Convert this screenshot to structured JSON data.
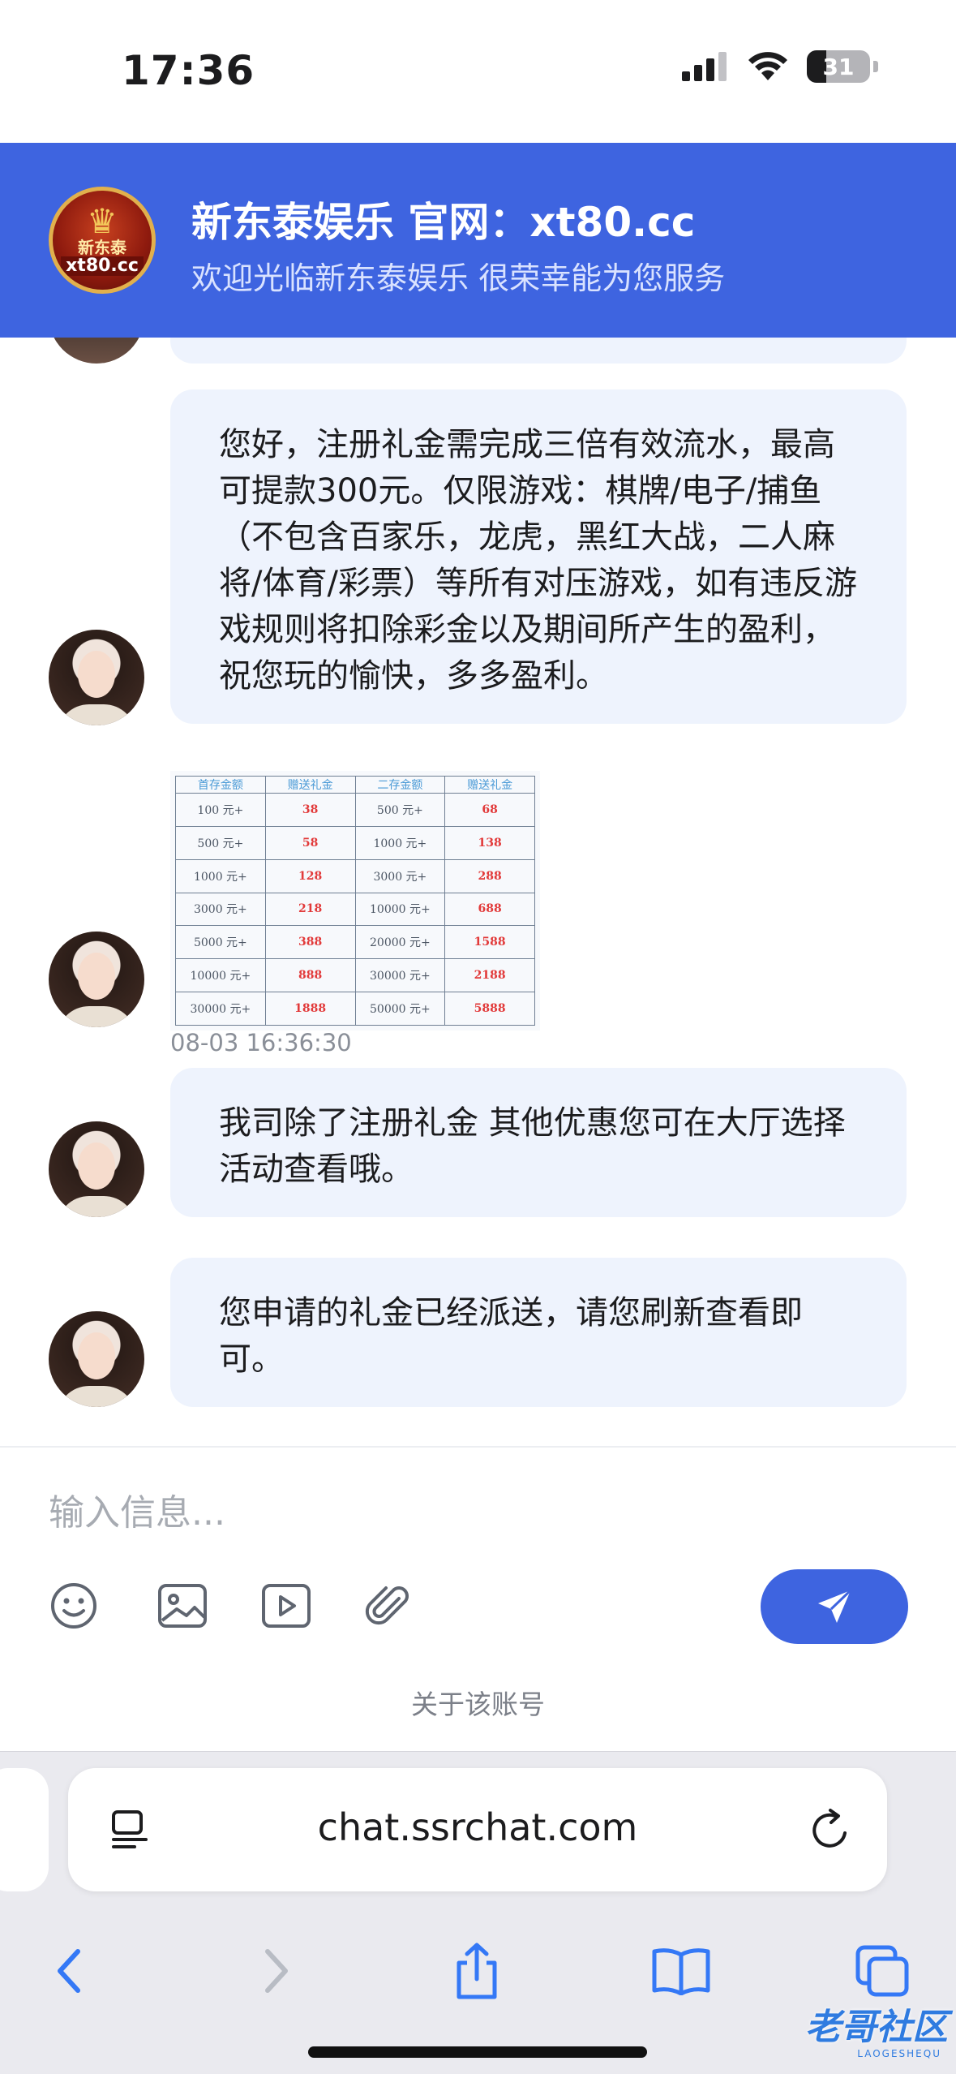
{
  "status_bar": {
    "time": "17:36",
    "battery": "31",
    "battery_level": 0.31
  },
  "header": {
    "logo_top": "新东泰",
    "logo_bottom": "xt80.cc",
    "title": "新东泰娱乐 官网：xt80.cc",
    "subtitle": "欢迎光临新东泰娱乐 很荣幸能为您服务"
  },
  "messages": [
    {
      "type": "text",
      "text": "您好，注册礼金需完成三倍有效流水，最高可提款300元。仅限游戏：棋牌/电子/捕鱼（不包含百家乐，龙虎，黑红大战，二人麻将/体育/彩票）等所有对压游戏，如有违反游戏规则将扣除彩金以及期间所产生的盈利，祝您玩的愉快，多多盈利。"
    },
    {
      "type": "image",
      "timestamp": "08-03 16:36:30",
      "table": {
        "headers": [
          "首存金额",
          "赠送礼金",
          "二存金额",
          "赠送礼金"
        ],
        "rows": [
          [
            "100 元+",
            "38",
            "500 元+",
            "68"
          ],
          [
            "500 元+",
            "58",
            "1000 元+",
            "138"
          ],
          [
            "1000 元+",
            "128",
            "3000 元+",
            "288"
          ],
          [
            "3000 元+",
            "218",
            "10000 元+",
            "688"
          ],
          [
            "5000 元+",
            "388",
            "20000 元+",
            "1588"
          ],
          [
            "10000 元+",
            "888",
            "30000 元+",
            "2188"
          ],
          [
            "30000 元+",
            "1888",
            "50000 元+",
            "5888"
          ]
        ]
      }
    },
    {
      "type": "text",
      "text": "我司除了注册礼金  其他优惠您可在大厅选择活动查看哦。"
    },
    {
      "type": "text",
      "text": "您申请的礼金已经派送，请您刷新查看即可。"
    }
  ],
  "composer": {
    "placeholder": "输入信息...",
    "tools": [
      "emoji-icon",
      "image-icon",
      "video-icon",
      "attachment-icon"
    ],
    "send_icon": "send-icon",
    "account_link": "关于该账号"
  },
  "browser": {
    "url": "chat.ssrchat.com",
    "nav_icons": [
      "back-icon",
      "forward-icon",
      "share-icon",
      "bookmarks-icon",
      "tabs-icon"
    ]
  },
  "watermark": {
    "text": "老哥社区",
    "sub": "LAOGESHEQU"
  },
  "colors": {
    "accent": "#3e64e0",
    "bubble": "#eef3fd",
    "red_value": "#e23a3a"
  }
}
